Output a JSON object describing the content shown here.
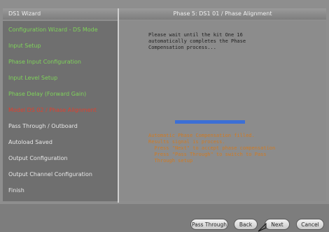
{
  "header": {
    "left_title": "DS1 Wizard",
    "right_title": "Phase 5: DS1 01 / Phase Alignment"
  },
  "sidebar": {
    "steps": [
      {
        "label": "Configuration Wizard - DS Mode",
        "color": "#7fd35a"
      },
      {
        "label": "Input Setup",
        "color": "#7fd35a"
      },
      {
        "label": "Phase Input Configuration",
        "color": "#7fd35a"
      },
      {
        "label": "Input Level Setup",
        "color": "#7fd35a"
      },
      {
        "label": "Phase Delay (Forward Gain)",
        "color": "#7fd35a"
      },
      {
        "label": "Model DS 02 / Phase Alignment",
        "color": "#e0402e"
      },
      {
        "label": "Pass Through / Outboard",
        "color": "#e8e8e8"
      },
      {
        "label": "Autoload Saved",
        "color": "#e8e8e8"
      },
      {
        "label": "Output Configuration",
        "color": "#e8e8e8"
      },
      {
        "label": "Output Channel Configuration",
        "color": "#e8e8e8"
      },
      {
        "label": "Finish",
        "color": "#e8e8e8"
      }
    ]
  },
  "content": {
    "message": "Please wait until the kit One 16\nautomatically completes the Phase\nCompensation process...",
    "progress": 1.0,
    "result": "Automatic Phase Compensation filled.\nResults signal is process.\n  Press \"Next\" to accept phase compensation\n  Press \"Pass Through\" to switch to Pass\n  Through setup"
  },
  "buttons": {
    "pass_through": "Pass Through",
    "back": "Back",
    "next": "Next",
    "cancel": "Cancel"
  },
  "colors": {
    "progress": "#3b6fd6",
    "result_text": "#d07a22"
  }
}
